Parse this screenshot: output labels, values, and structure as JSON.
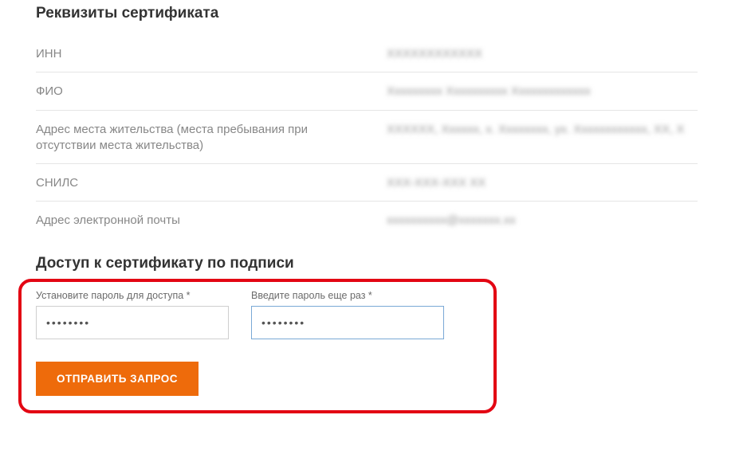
{
  "section1": {
    "title": "Реквизиты сертификата",
    "rows": [
      {
        "label": "ИНН",
        "value": "XXXXXXXXXXXX"
      },
      {
        "label": "ФИО",
        "value": "Xxxxxxxxx Xxxxxxxxxx Xxxxxxxxxxxxx"
      },
      {
        "label": "Адрес места жительства (места пребывания при отсутствии места жительства)",
        "value": "XXXXXX, Xxxxxx, x. Xxxxxxxx, yx. Xxxxxxxxxxxx, XX, X"
      },
      {
        "label": "СНИЛС",
        "value": "XXX-XXX-XXX XX"
      },
      {
        "label": "Адрес электронной почты",
        "value": "xxxxxxxxxx@xxxxxxx.xx"
      }
    ]
  },
  "section2": {
    "title": "Доступ к сертификату по подписи",
    "password1_label": "Установите пароль для доступа *",
    "password2_label": "Введите пароль еще раз *",
    "password1_value": "••••••••",
    "password2_value": "••••••••",
    "submit_label": "ОТПРАВИТЬ ЗАПРОС"
  }
}
